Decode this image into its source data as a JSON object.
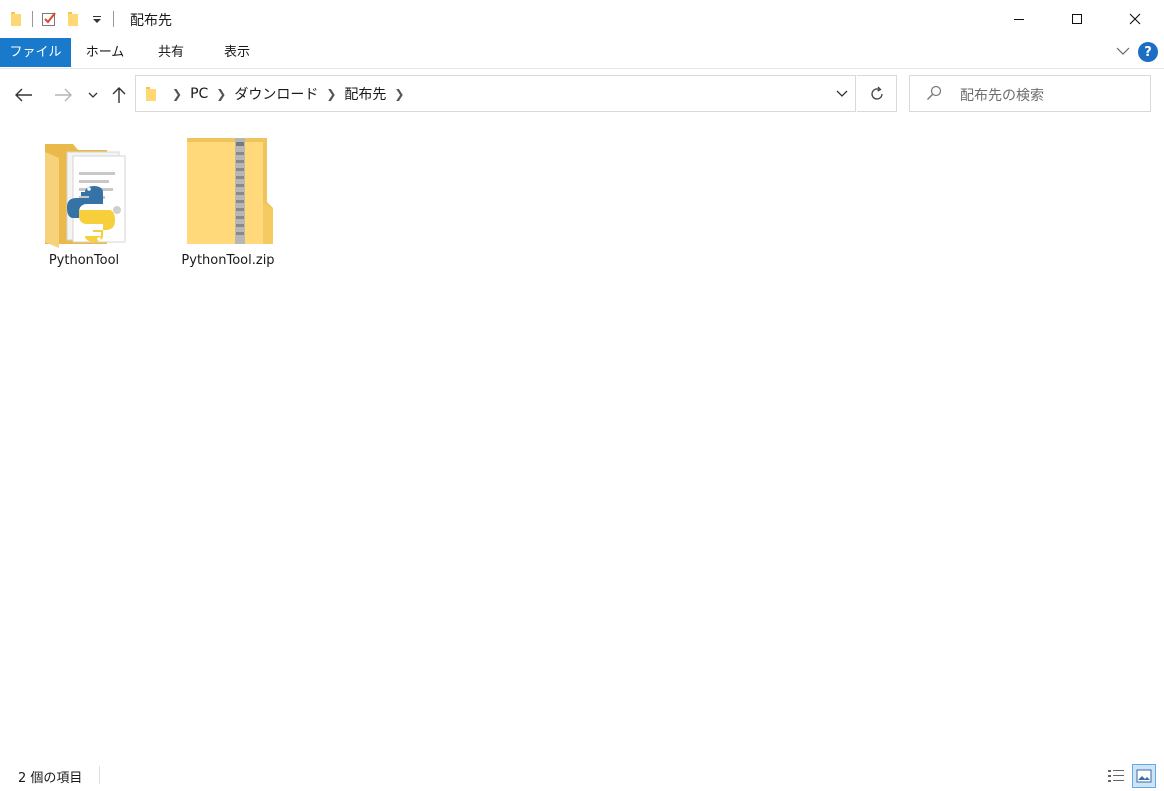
{
  "window": {
    "title": "配布先"
  },
  "ribbon": {
    "tabs": [
      {
        "label": "ファイル"
      },
      {
        "label": "ホーム"
      },
      {
        "label": "共有"
      },
      {
        "label": "表示"
      }
    ]
  },
  "address_bar": {
    "breadcrumb": [
      "PC",
      "ダウンロード",
      "配布先"
    ]
  },
  "search": {
    "placeholder": "配布先の検索"
  },
  "files": [
    {
      "name": "PythonTool",
      "type": "folder",
      "icon": "python-folder-icon"
    },
    {
      "name": "PythonTool.zip",
      "type": "zip",
      "icon": "zip-folder-icon"
    }
  ],
  "status_bar": {
    "item_count": "2 個の項目"
  },
  "colors": {
    "accent": "#1979ca",
    "folder_yellow": "#f6d37a",
    "help_blue": "#1b6ec2"
  }
}
